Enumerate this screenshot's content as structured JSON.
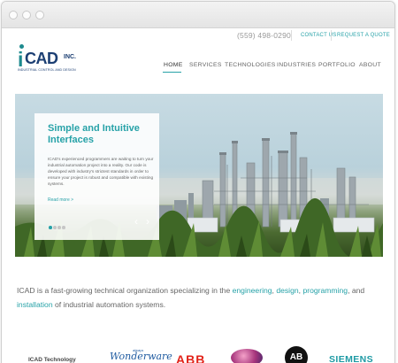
{
  "utility": {
    "phone": "(559) 498-0290",
    "contact_label": "CONTACT US",
    "quote_label": "REQUEST A QUOTE"
  },
  "logo": {
    "i": "i",
    "cad": "CAD",
    "inc": "INC.",
    "tagline": "INDUSTRIAL CONTROL AND DESIGN"
  },
  "nav": {
    "items": [
      {
        "label": "HOME",
        "active": true
      },
      {
        "label": "SERVICES"
      },
      {
        "label": "TECHNOLOGIES"
      },
      {
        "label": "INDUSTRIES"
      },
      {
        "label": "PORTFOLIO"
      },
      {
        "label": "ABOUT"
      }
    ]
  },
  "hero": {
    "title": "Simple and Intuitive Interfaces",
    "body": "ICAD's experienced programmers are waiting to turn your industrial automation project into a reality. Our code is developed with industry's strictest standards in order to ensure your project is robust and compatible with existing systems.",
    "more": "Read more >",
    "prev_icon": "‹",
    "next_icon": "›",
    "slide_count": 4,
    "active_slide": 1
  },
  "intro": {
    "text_1": "ICAD is a fast-growing technical organization specializing in the ",
    "link_engineering": "engineering",
    "sep_1": ", ",
    "link_design": "design",
    "sep_2": ", ",
    "link_programming": "programming",
    "sep_3": ", and ",
    "link_installation": "installation",
    "text_2": " of industrial automation systems."
  },
  "partners": {
    "label": "ICAD Technology",
    "wonderware": "Wonderware",
    "wonderware_tag": "always",
    "abb": "ABB",
    "ab": "AB",
    "siemens": "SIEMENS"
  },
  "colors": {
    "accent": "#27a2a8",
    "logo_navy": "#1c3f73",
    "logo_teal": "#1d8a8e"
  }
}
